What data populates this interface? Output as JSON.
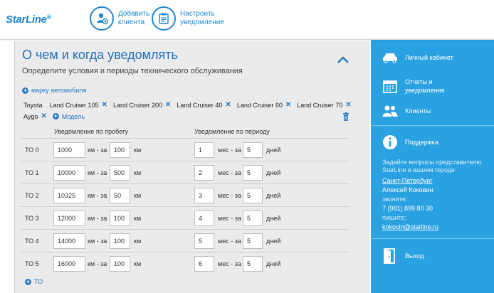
{
  "header": {
    "logo": "StarLine",
    "add_client": "Добавить клиента",
    "configure_notification": "Настроить уведомление"
  },
  "main": {
    "title": "О чем и когда уведомлять",
    "subtitle": "Определите условия и периоды технического обслуживания",
    "add_make": "марку автомобиля",
    "make": "Toyota",
    "models": [
      "Land Cruiser 105",
      "Land Cruiser 200",
      "Land Cruiser 40",
      "Land Cruiser 60",
      "Land Cruiser 70",
      "Aygo"
    ],
    "add_model": "Модель",
    "col_mileage": "Уведомление по пробегу",
    "col_period": "Уведомление по периоду",
    "unit_km_range": "км - за",
    "unit_km": "км",
    "unit_months_range": "мес - за",
    "unit_days": "дней",
    "rows": [
      {
        "to": "ТО 0",
        "km": "1000",
        "km_window": "100",
        "months": "1",
        "days": "5"
      },
      {
        "to": "ТО 1",
        "km": "10000",
        "km_window": "500",
        "months": "2",
        "days": "5"
      },
      {
        "to": "ТО 2",
        "km": "10325",
        "km_window": "50",
        "months": "3",
        "days": "5"
      },
      {
        "to": "ТО 3",
        "km": "12000",
        "km_window": "100",
        "months": "4",
        "days": "5"
      },
      {
        "to": "ТО 4",
        "km": "14000",
        "km_window": "100",
        "months": "5",
        "days": "5"
      },
      {
        "to": "ТО 5",
        "km": "16000",
        "km_window": "100",
        "months": "6",
        "days": "5"
      }
    ],
    "add_to": "ТО"
  },
  "sidebar": {
    "cabinet": "Личный кабинет",
    "reports": "Отчеты и уведомления",
    "clients": "Клиенты",
    "support": "Поддержка",
    "support_text": "Задайте вопросы представителю StarLine в вашем городе",
    "city": "Санкт-Петербург",
    "rep_name": "Алексей  Коковин",
    "call_label": "звоните:",
    "phone": "7 (981) 899 80 30",
    "write_label": "пишите:",
    "email": "kokovin@starline.ru",
    "logout": "Выход"
  },
  "colors": {
    "brand": "#1f87d1",
    "sidebar": "#2aa1e0",
    "panel": "#ebebeb",
    "title": "#2470b8"
  },
  "icons": [
    "add-client-icon",
    "notification-settings-icon",
    "chevron-up-icon",
    "plus-icon",
    "remove-x-icon",
    "trash-icon",
    "car-icon",
    "calendar-icon",
    "clients-icon",
    "info-icon",
    "exit-door-icon"
  ]
}
